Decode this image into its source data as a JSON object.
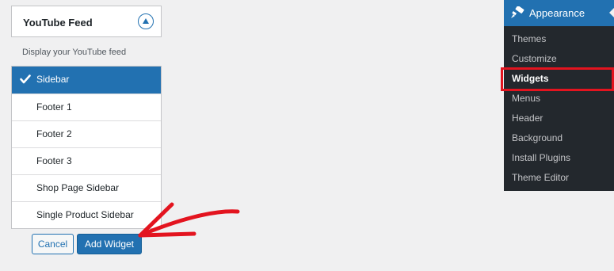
{
  "widget": {
    "title": "YouTube Feed",
    "description": "Display your YouTube feed",
    "toggle_icon": "triangle-up-icon"
  },
  "areas": [
    {
      "label": "Sidebar",
      "selected": true
    },
    {
      "label": "Footer 1",
      "selected": false
    },
    {
      "label": "Footer 2",
      "selected": false
    },
    {
      "label": "Footer 3",
      "selected": false
    },
    {
      "label": "Shop Page Sidebar",
      "selected": false
    },
    {
      "label": "Single Product Sidebar",
      "selected": false
    }
  ],
  "buttons": {
    "cancel_label": "Cancel",
    "add_label": "Add Widget"
  },
  "admin_menu": {
    "parent_label": "Appearance",
    "parent_icon": "paintbrush-icon",
    "items": [
      {
        "label": "Themes",
        "current": false
      },
      {
        "label": "Customize",
        "current": false
      },
      {
        "label": "Widgets",
        "current": true
      },
      {
        "label": "Menus",
        "current": false
      },
      {
        "label": "Header",
        "current": false
      },
      {
        "label": "Background",
        "current": false
      },
      {
        "label": "Install Plugins",
        "current": false
      },
      {
        "label": "Theme Editor",
        "current": false
      }
    ]
  },
  "colors": {
    "accent": "#2271b1",
    "menu_bg": "#23282d",
    "annotation": "#e3141f"
  }
}
